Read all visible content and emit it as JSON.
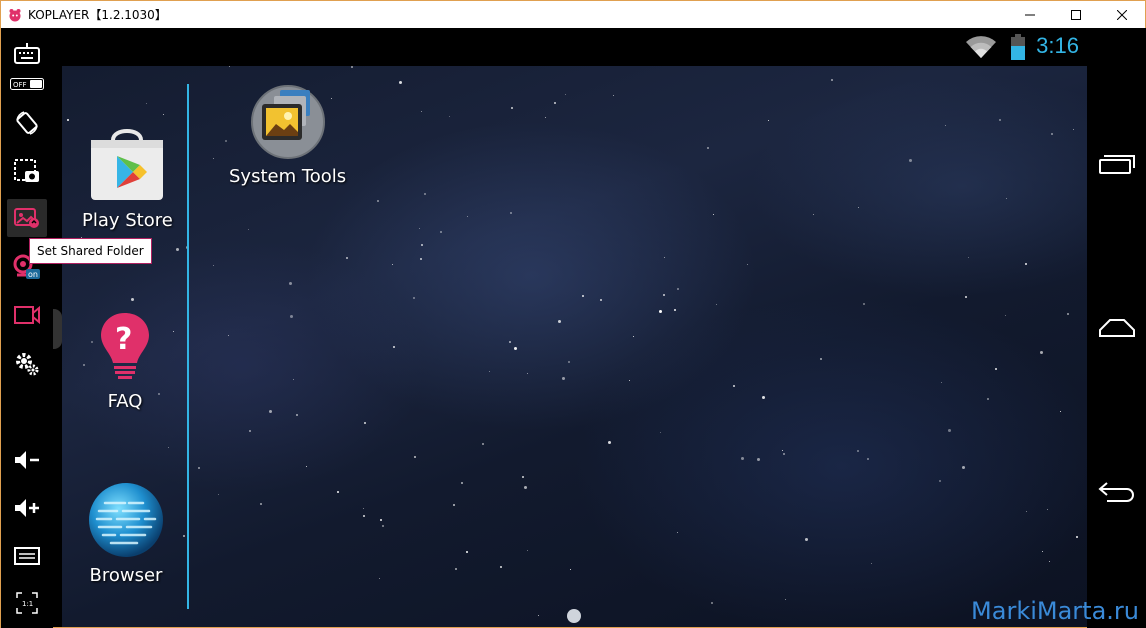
{
  "window": {
    "title": "KOPLAYER【1.2.1030】",
    "controls": [
      "minimize",
      "maximize",
      "close"
    ]
  },
  "toolbar": {
    "items": [
      {
        "name": "keyboard-icon",
        "toggle_label": "OFF"
      },
      {
        "name": "rotate-icon"
      },
      {
        "name": "screenshot-icon"
      },
      {
        "name": "shared-folder-icon"
      },
      {
        "name": "location-icon",
        "badge": "on"
      },
      {
        "name": "video-record-icon"
      },
      {
        "name": "settings-icon"
      },
      {
        "name": "volume-down-icon"
      },
      {
        "name": "volume-up-icon"
      },
      {
        "name": "menu-icon"
      },
      {
        "name": "aspect-ratio-icon",
        "label": "1:1"
      }
    ],
    "tooltip": "Set Shared Folder"
  },
  "statusbar": {
    "time": "3:16",
    "icons": [
      "wifi-icon",
      "battery-icon"
    ]
  },
  "dock": {
    "apps": [
      {
        "label": "Play Store",
        "icon": "play-store-icon"
      },
      {
        "label": "FAQ",
        "icon": "faq-lightbulb-icon"
      },
      {
        "label": "Browser",
        "icon": "browser-globe-icon"
      }
    ]
  },
  "home": {
    "apps": [
      {
        "label": "System Tools",
        "icon": "system-tools-folder-icon"
      }
    ]
  },
  "navbar": {
    "buttons": [
      "recent-apps-icon",
      "home-icon",
      "back-icon"
    ]
  },
  "colors": {
    "accent": "#33b5e5",
    "toolbar_pink": "#e0306a",
    "window_border": "#e0a050"
  },
  "watermark": "MarkiMarta.ru"
}
